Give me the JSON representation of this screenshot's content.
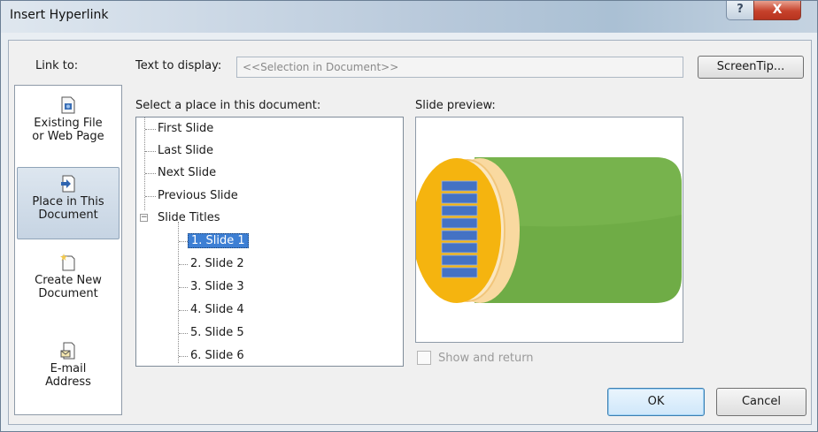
{
  "window": {
    "title": "Insert Hyperlink",
    "help_glyph": "?",
    "close_glyph": "X"
  },
  "link_to": {
    "label": "Link to:",
    "options": [
      {
        "line1": "Existing File",
        "line2": "or Web Page",
        "icon": "existing-file-icon"
      },
      {
        "line1": "Place in This",
        "line2": "Document",
        "icon": "place-in-document-icon"
      },
      {
        "line1": "Create New",
        "line2": "Document",
        "icon": "create-new-document-icon"
      },
      {
        "line1": "E-mail",
        "line2": "Address",
        "icon": "email-address-icon"
      }
    ],
    "selected": "Place in This Document"
  },
  "text_to_display": {
    "label": "Text to display:",
    "value": "<<Selection in Document>>"
  },
  "screentip_label": "ScreenTip...",
  "place_list": {
    "label": "Select a place in this document:",
    "items": [
      "First Slide",
      "Last Slide",
      "Next Slide",
      "Previous Slide",
      "Slide Titles"
    ],
    "slides": [
      "1. Slide 1",
      "2. Slide 2",
      "3. Slide 3",
      "4. Slide 4",
      "5. Slide 5",
      "6. Slide 6"
    ],
    "expander_glyph": "−",
    "selected": "1. Slide 1"
  },
  "preview": {
    "label": "Slide preview:",
    "colors": {
      "orange": "#f5b40f",
      "pale_orange": "#f9d9a0",
      "green": "#6fac46",
      "dark_green": "#4f8a2c",
      "blue": "#4472c4"
    }
  },
  "show_and_return": {
    "label": "Show and return",
    "checked": false,
    "enabled": false
  },
  "buttons": {
    "ok": "OK",
    "cancel": "Cancel"
  }
}
